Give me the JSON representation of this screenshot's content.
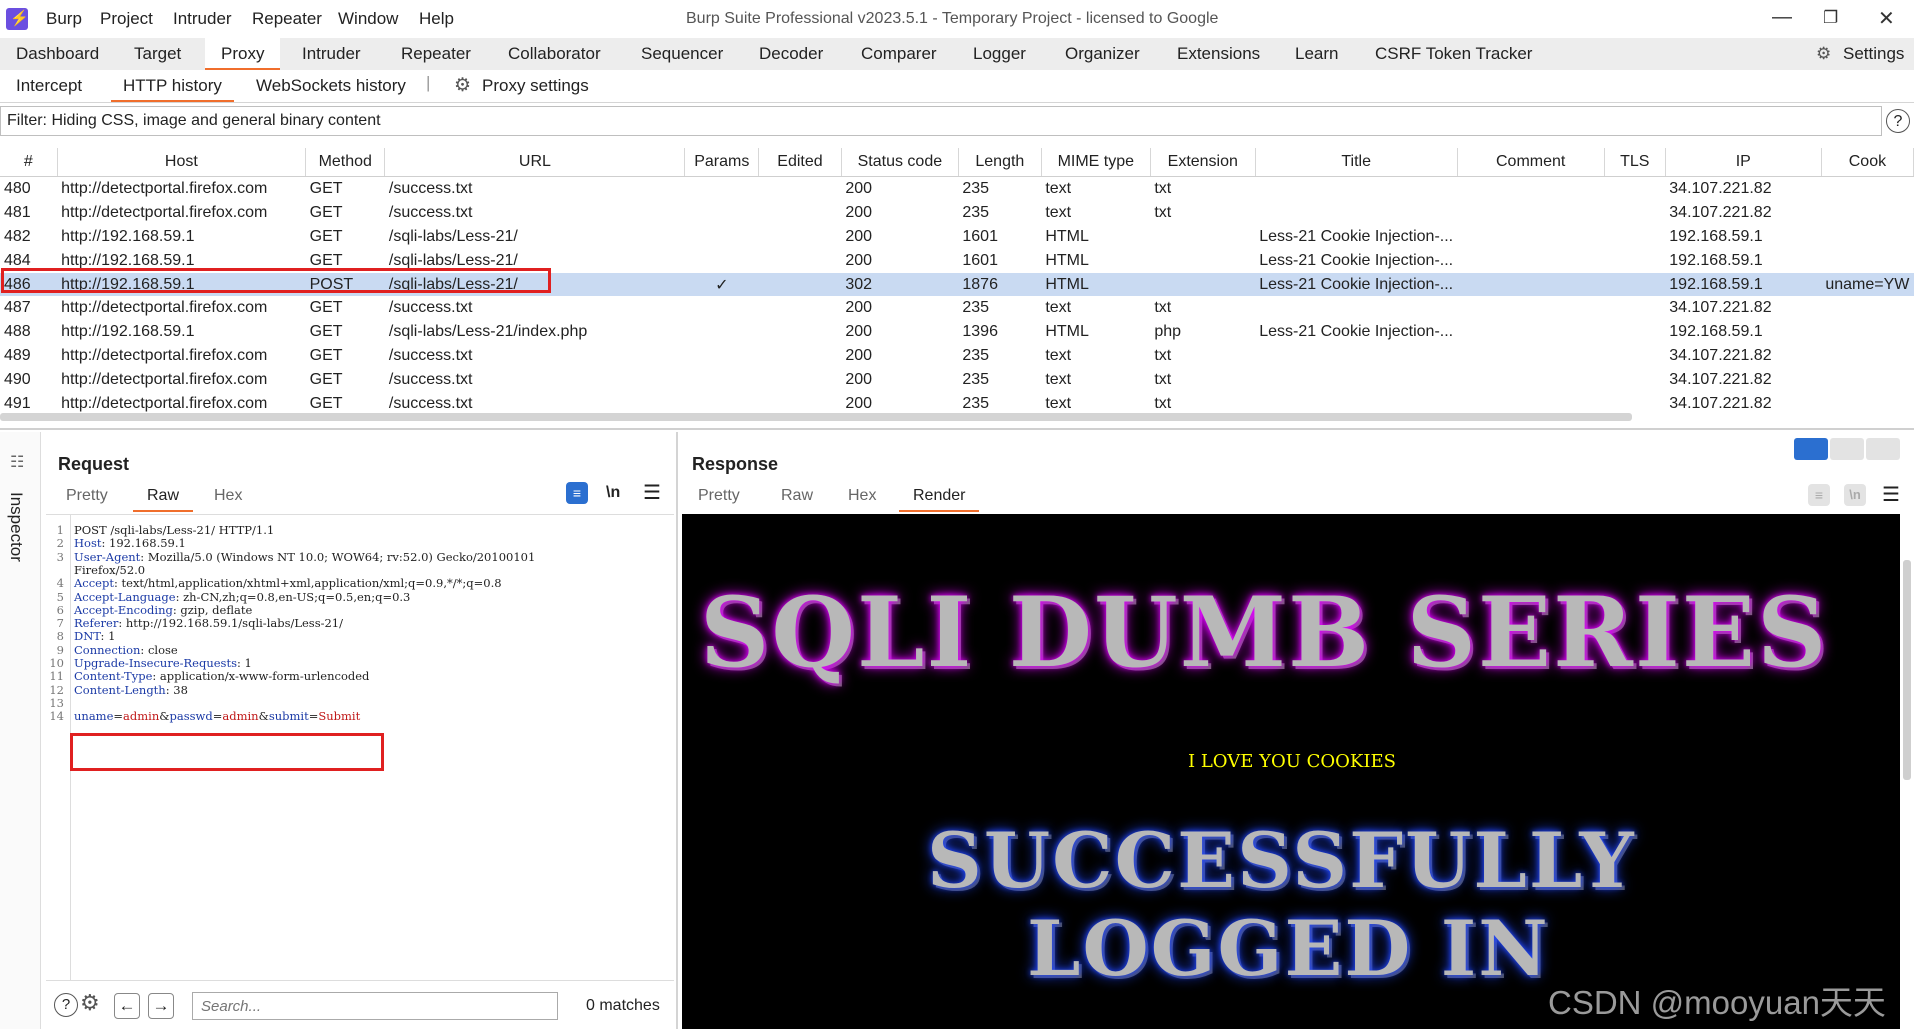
{
  "titlebar": {
    "menus": [
      "Burp",
      "Project",
      "Intruder",
      "Repeater",
      "Window",
      "Help"
    ],
    "title": "Burp Suite Professional v2023.5.1 - Temporary Project - licensed to Google"
  },
  "main_tabs": [
    "Dashboard",
    "Target",
    "Proxy",
    "Intruder",
    "Repeater",
    "Collaborator",
    "Sequencer",
    "Decoder",
    "Comparer",
    "Logger",
    "Organizer",
    "Extensions",
    "Learn",
    "CSRF Token Tracker"
  ],
  "settings_label": "Settings",
  "sub_tabs": [
    "Intercept",
    "HTTP history",
    "WebSockets history"
  ],
  "proxy_settings_label": "Proxy settings",
  "filter_text": "Filter: Hiding CSS, image and general binary content",
  "table": {
    "columns": [
      "#",
      "Host",
      "Method",
      "URL",
      "Params",
      "Edited",
      "Status code",
      "Length",
      "MIME type",
      "Extension",
      "Title",
      "Comment",
      "TLS",
      "IP",
      "Cook"
    ],
    "rows": [
      [
        "480",
        "http://detectportal.firefox.com",
        "GET",
        "/success.txt",
        "",
        "",
        "200",
        "235",
        "text",
        "txt",
        "",
        "",
        "",
        "34.107.221.82",
        ""
      ],
      [
        "481",
        "http://detectportal.firefox.com",
        "GET",
        "/success.txt",
        "",
        "",
        "200",
        "235",
        "text",
        "txt",
        "",
        "",
        "",
        "34.107.221.82",
        ""
      ],
      [
        "482",
        "http://192.168.59.1",
        "GET",
        "/sqli-labs/Less-21/",
        "",
        "",
        "200",
        "1601",
        "HTML",
        "",
        "Less-21 Cookie Injection-...",
        "",
        "",
        "192.168.59.1",
        ""
      ],
      [
        "484",
        "http://192.168.59.1",
        "GET",
        "/sqli-labs/Less-21/",
        "",
        "",
        "200",
        "1601",
        "HTML",
        "",
        "Less-21 Cookie Injection-...",
        "",
        "",
        "192.168.59.1",
        ""
      ],
      [
        "486",
        "http://192.168.59.1",
        "POST",
        "/sqli-labs/Less-21/",
        "✓",
        "",
        "302",
        "1876",
        "HTML",
        "",
        "Less-21 Cookie Injection-...",
        "",
        "",
        "192.168.59.1",
        "uname=YW"
      ],
      [
        "487",
        "http://detectportal.firefox.com",
        "GET",
        "/success.txt",
        "",
        "",
        "200",
        "235",
        "text",
        "txt",
        "",
        "",
        "",
        "34.107.221.82",
        ""
      ],
      [
        "488",
        "http://192.168.59.1",
        "GET",
        "/sqli-labs/Less-21/index.php",
        "",
        "",
        "200",
        "1396",
        "HTML",
        "php",
        "Less-21 Cookie Injection-...",
        "",
        "",
        "192.168.59.1",
        ""
      ],
      [
        "489",
        "http://detectportal.firefox.com",
        "GET",
        "/success.txt",
        "",
        "",
        "200",
        "235",
        "text",
        "txt",
        "",
        "",
        "",
        "34.107.221.82",
        ""
      ],
      [
        "490",
        "http://detectportal.firefox.com",
        "GET",
        "/success.txt",
        "",
        "",
        "200",
        "235",
        "text",
        "txt",
        "",
        "",
        "",
        "34.107.221.82",
        ""
      ],
      [
        "491",
        "http://detectportal.firefox.com",
        "GET",
        "/success.txt",
        "",
        "",
        "200",
        "235",
        "text",
        "txt",
        "",
        "",
        "",
        "34.107.221.82",
        ""
      ]
    ],
    "selected_row": "486"
  },
  "inspector_label": "Inspector",
  "request": {
    "title": "Request",
    "tabs": [
      "Pretty",
      "Raw",
      "Hex"
    ],
    "active_tab": "Raw",
    "newline_btn": "\\n",
    "lines": [
      {
        "n": "1",
        "name": "",
        "value": "POST /sqli-labs/Less-21/ HTTP/1.1"
      },
      {
        "n": "2",
        "name": "Host",
        "value": " 192.168.59.1"
      },
      {
        "n": "3",
        "name": "User-Agent",
        "value": " Mozilla/5.0 (Windows NT 10.0; WOW64; rv:52.0) Gecko/20100101"
      },
      {
        "n": "",
        "name": "",
        "value": "Firefox/52.0"
      },
      {
        "n": "4",
        "name": "Accept",
        "value": " text/html,application/xhtml+xml,application/xml;q=0.9,*/*;q=0.8"
      },
      {
        "n": "5",
        "name": "Accept-Language",
        "value": " zh-CN,zh;q=0.8,en-US;q=0.5,en;q=0.3"
      },
      {
        "n": "6",
        "name": "Accept-Encoding",
        "value": " gzip, deflate"
      },
      {
        "n": "7",
        "name": "Referer",
        "value": " http://192.168.59.1/sqli-labs/Less-21/"
      },
      {
        "n": "8",
        "name": "DNT",
        "value": " 1"
      },
      {
        "n": "9",
        "name": "Connection",
        "value": " close"
      },
      {
        "n": "10",
        "name": "Upgrade-Insecure-Requests",
        "value": " 1"
      },
      {
        "n": "11",
        "name": "Content-Type",
        "value": " application/x-www-form-urlencoded"
      },
      {
        "n": "12",
        "name": "Content-Length",
        "value": " 38"
      },
      {
        "n": "13",
        "name": "",
        "value": ""
      }
    ],
    "body_line_number": "14",
    "body_params": [
      {
        "name": "uname",
        "value": "admin"
      },
      {
        "name": "passwd",
        "value": "admin"
      },
      {
        "name": "submit",
        "value": "Submit"
      }
    ],
    "search_placeholder": "Search...",
    "matches": "0 matches"
  },
  "response": {
    "title": "Response",
    "tabs": [
      "Pretty",
      "Raw",
      "Hex",
      "Render"
    ],
    "active_tab": "Render",
    "newline_btn": "\\n",
    "render": {
      "banner": "SQLI DUMB SERIES",
      "cookie_text": "I LOVE YOU COOKIES",
      "success_line1": "SUCCESSFULLY",
      "success_line2": "LOGGED IN"
    }
  },
  "watermark": "CSDN @mooyuan天天",
  "colors": {
    "accent": "#f06e2c",
    "selected_row": "#c9daf2",
    "highlight_box": "#e02020",
    "header_name": "#1b3aa6",
    "param_value": "#c01818"
  },
  "icons": {
    "logo": "burp-logo-icon",
    "help": "help-icon",
    "settings": "gear-icon"
  }
}
